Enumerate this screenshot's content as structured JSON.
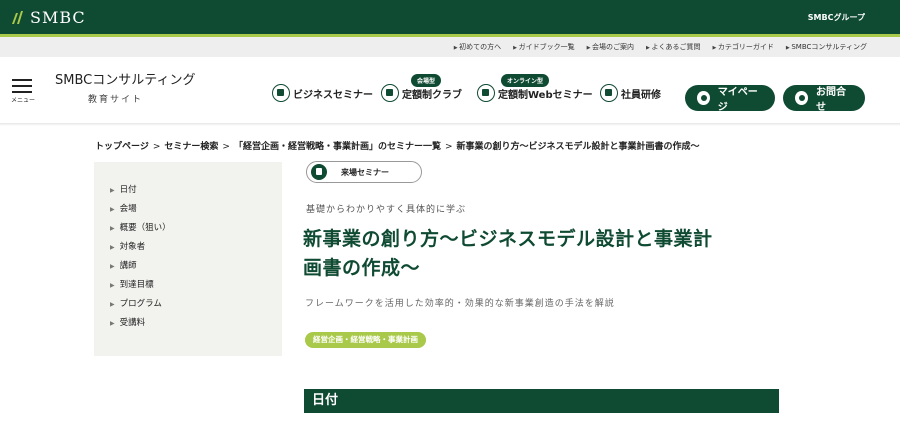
{
  "brand": {
    "logo_text": "SMBC",
    "group_link": "SMBCグループ"
  },
  "utility_links": [
    "初めての方へ",
    "ガイドブック一覧",
    "会場のご案内",
    "よくあるご質問",
    "カテゴリーガイド",
    "SMBCコンサルティング"
  ],
  "header": {
    "menu_label": "メニュー",
    "site_title": "SMBCコンサルティング",
    "site_subtitle": "教育サイト",
    "nav": [
      {
        "label": "ビジネスセミナー",
        "badge": "",
        "icon": "seminar-icon"
      },
      {
        "label": "定額制クラブ",
        "badge": "会場型",
        "icon": "club-icon"
      },
      {
        "label": "定額制Webセミナー",
        "badge": "オンライン型",
        "icon": "web-seminar-icon"
      },
      {
        "label": "社員研修",
        "badge": "",
        "icon": "training-icon"
      }
    ],
    "mypage_label": "マイページ",
    "contact_label": "お問合せ"
  },
  "breadcrumb": [
    "トップページ",
    "セミナー検索",
    "「経営企画・経営戦略・事業計画」のセミナー一覧",
    "新事業の創り方～ビジネスモデル設計と事業計画書の作成～"
  ],
  "sidebar": {
    "items": [
      "日付",
      "会場",
      "概要（狙い）",
      "対象者",
      "講師",
      "到達目標",
      "プログラム",
      "受講料"
    ]
  },
  "main": {
    "seminar_type": "来場セミナー",
    "lead": "基礎からわかりやすく具体的に学ぶ",
    "title_line1": "新事業の創り方～ビジネスモデル設計と事業計",
    "title_line2": "画書の作成～",
    "subtitle": "フレームワークを活用した効率的・効果的な新事業創造の手法を解説",
    "category": "経営企画・経営戦略・事業計画",
    "section_date": "日付"
  },
  "colors": {
    "primary": "#0f4a32",
    "accent": "#a9c94a",
    "sidebar_bg": "#f2f2ef"
  }
}
